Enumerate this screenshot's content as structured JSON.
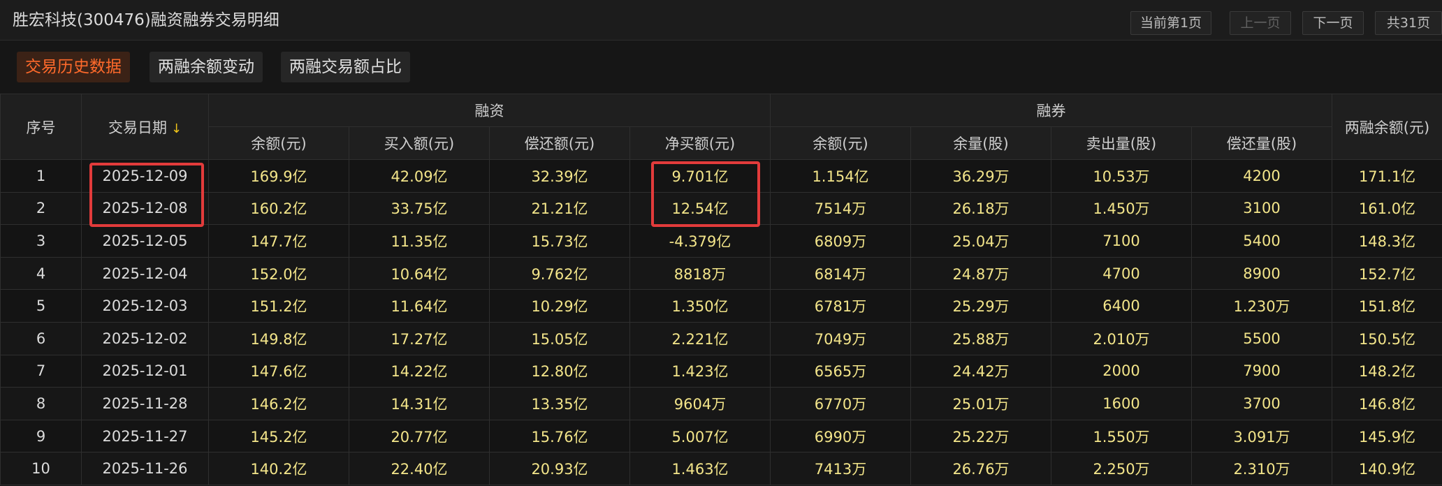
{
  "header": {
    "title": "胜宏科技(300476)融资融券交易明细",
    "pager": {
      "current": "当前第1页",
      "prev": "上一页",
      "next": "下一页",
      "total": "共31页"
    }
  },
  "tabs": [
    {
      "label": "交易历史数据",
      "active": true
    },
    {
      "label": "两融余额变动",
      "active": false
    },
    {
      "label": "两融交易额占比",
      "active": false
    }
  ],
  "table": {
    "group_headers": {
      "seq": "序号",
      "date": "交易日期",
      "financing": "融资",
      "securities_lending": "融券",
      "total": "两融余额(元)"
    },
    "sub_headers": [
      "余额(元)",
      "买入额(元)",
      "偿还额(元)",
      "净买额(元)",
      "余额(元)",
      "余量(股)",
      "卖出量(股)",
      "偿还量(股)"
    ],
    "sort_icon": "sort-down-arrow-icon",
    "rows": [
      [
        "1",
        "2025-12-09",
        "169.9亿",
        "42.09亿",
        "32.39亿",
        "9.701亿",
        "1.154亿",
        "36.29万",
        "10.53万",
        "4200",
        "171.1亿"
      ],
      [
        "2",
        "2025-12-08",
        "160.2亿",
        "33.75亿",
        "21.21亿",
        "12.54亿",
        "7514万",
        "26.18万",
        "1.450万",
        "3100",
        "161.0亿"
      ],
      [
        "3",
        "2025-12-05",
        "147.7亿",
        "11.35亿",
        "15.73亿",
        "-4.379亿",
        "6809万",
        "25.04万",
        "7100",
        "5400",
        "148.3亿"
      ],
      [
        "4",
        "2025-12-04",
        "152.0亿",
        "10.64亿",
        "9.762亿",
        "8818万",
        "6814万",
        "24.87万",
        "4700",
        "8900",
        "152.7亿"
      ],
      [
        "5",
        "2025-12-03",
        "151.2亿",
        "11.64亿",
        "10.29亿",
        "1.350亿",
        "6781万",
        "25.29万",
        "6400",
        "1.230万",
        "151.8亿"
      ],
      [
        "6",
        "2025-12-02",
        "149.8亿",
        "17.27亿",
        "15.05亿",
        "2.221亿",
        "7049万",
        "25.88万",
        "2.010万",
        "5500",
        "150.5亿"
      ],
      [
        "7",
        "2025-12-01",
        "147.6亿",
        "14.22亿",
        "12.80亿",
        "1.423亿",
        "6565万",
        "24.42万",
        "2000",
        "7900",
        "148.2亿"
      ],
      [
        "8",
        "2025-11-28",
        "146.2亿",
        "14.31亿",
        "13.35亿",
        "9604万",
        "6770万",
        "25.01万",
        "1600",
        "3700",
        "146.8亿"
      ],
      [
        "9",
        "2025-11-27",
        "145.2亿",
        "20.77亿",
        "15.76亿",
        "5.007亿",
        "6990万",
        "25.22万",
        "1.550万",
        "3.091万",
        "145.9亿"
      ],
      [
        "10",
        "2025-11-26",
        "140.2亿",
        "22.40亿",
        "20.93亿",
        "1.463亿",
        "7413万",
        "26.76万",
        "2.250万",
        "2.310万",
        "140.9亿"
      ]
    ]
  },
  "colors": {
    "background": "#161616",
    "value_text": "#f3e58a",
    "accent": "#ff6a2b",
    "highlight_box": "#e23b3b"
  }
}
